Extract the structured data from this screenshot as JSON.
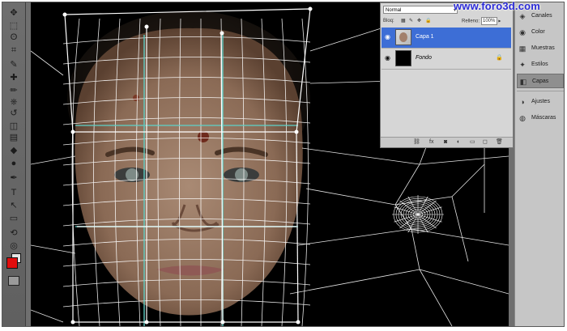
{
  "watermark": "www.foro3d.com",
  "tools": {
    "icons": [
      "move-tool-icon",
      "marquee-tool-icon",
      "lasso-tool-icon",
      "crop-tool-icon",
      "eyedropper-tool-icon",
      "healing-brush-icon",
      "brush-tool-icon",
      "clone-stamp-icon",
      "history-brush-icon",
      "eraser-tool-icon",
      "gradient-tool-icon",
      "blur-tool-icon",
      "dodge-tool-icon",
      "pen-tool-icon",
      "type-tool-icon",
      "path-select-icon",
      "shape-tool-icon",
      "3d-rotate-icon",
      "3d-orbit-icon",
      "hand-tool-icon",
      "zoom-tool-icon"
    ],
    "glyphs": [
      "✥",
      "⬚",
      "ʘ",
      "⌗",
      "✎",
      "✚",
      "✏",
      "⎈",
      "↺",
      "◫",
      "▤",
      "◆",
      "●",
      "✒",
      "T",
      "↖",
      "▭",
      "⟲",
      "◎",
      "✋",
      "🔍"
    ],
    "foreground_color": "#e10d0d",
    "background_color": "#e6e6e6"
  },
  "layers_panel": {
    "blend_mode": "Normal",
    "lock_label": "Bloq:",
    "fill_label": "Relleno:",
    "fill_value": "100%",
    "layers": [
      {
        "name": "Capa 1",
        "selected": true
      },
      {
        "name": "Fondo",
        "selected": false,
        "locked": true
      }
    ],
    "footer_icons": [
      "link-layers-icon",
      "fx-icon",
      "mask-icon",
      "adjustment-icon",
      "group-icon",
      "new-layer-icon",
      "trash-icon"
    ],
    "footer_glyphs": [
      "⛓",
      "fx",
      "◙",
      "◐",
      "▭",
      "◻",
      "🗑"
    ]
  },
  "dock": {
    "items": [
      {
        "label": "Canales",
        "icon": "channels-icon",
        "glyph": "◈"
      },
      {
        "label": "Color",
        "icon": "color-icon",
        "glyph": "◉"
      },
      {
        "label": "Muestras",
        "icon": "swatches-icon",
        "glyph": "▦"
      },
      {
        "label": "Estilos",
        "icon": "styles-icon",
        "glyph": "✦"
      },
      {
        "label": "Capas",
        "icon": "layers-icon",
        "glyph": "◧",
        "active": true
      },
      {
        "label": "Ajustes",
        "icon": "adjustments-icon",
        "glyph": "◑"
      },
      {
        "label": "Máscaras",
        "icon": "masks-icon",
        "glyph": "◍"
      }
    ]
  },
  "colors": {
    "selected_layer": "#3d6ed6",
    "canvas": "#000000",
    "mesh": "#ffffff",
    "guide": "#5fd1c8"
  }
}
